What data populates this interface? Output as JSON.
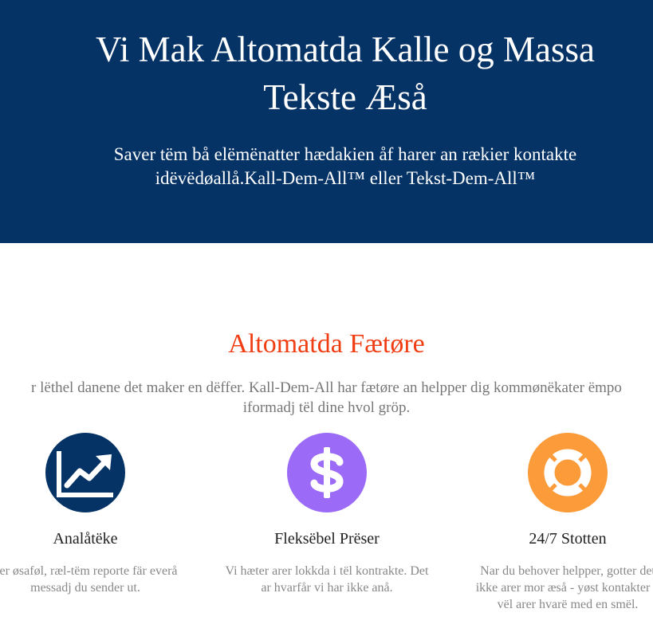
{
  "hero": {
    "title_line1": "Vi Mak Altomatda Kalle og Massa",
    "title_line2": "Tekste Æså",
    "subtitle_line1": "Saver tëm bå elëmënatter hædakien åf harer an rækier kontakte",
    "subtitle_line2": "idëvëdøallå.Kall-Dem-All™ eller Tekst-Dem-All™"
  },
  "features": {
    "title": "Altomatda Fætøre",
    "intro_line1": "r lëthel danene det maker en dëffer. Kall-Dem-All har fætøre an helpper dig kommønëkater ëmpo",
    "intro_line2": "iformadj tël dine hvol gröp.",
    "items": [
      {
        "icon": "analytics-chart-icon",
        "color": "#063366",
        "title": "Analåtëke",
        "text_line1": "ver øsaføl, ræl-tëm reporte fär everå",
        "text_line2": "messadj du sender ut.",
        "text_line3": ""
      },
      {
        "icon": "dollar-sign-icon",
        "color": "#9b6af6",
        "title": "Fleksëbel Prëser",
        "text_line1": "Vi hæter arer lokkda i tël kontrakte. Det",
        "text_line2": "ar hvarfår vi har ikke anå.",
        "text_line3": ""
      },
      {
        "icon": "lifebuoy-icon",
        "color": "#fb9b3a",
        "title": "24/7 Stotten",
        "text_line1": "Nar du behover helpper, gotter det",
        "text_line2": "ikke arer mor æså - yøst kontakter o",
        "text_line3": "vël arer hvarë med en smël."
      }
    ]
  }
}
